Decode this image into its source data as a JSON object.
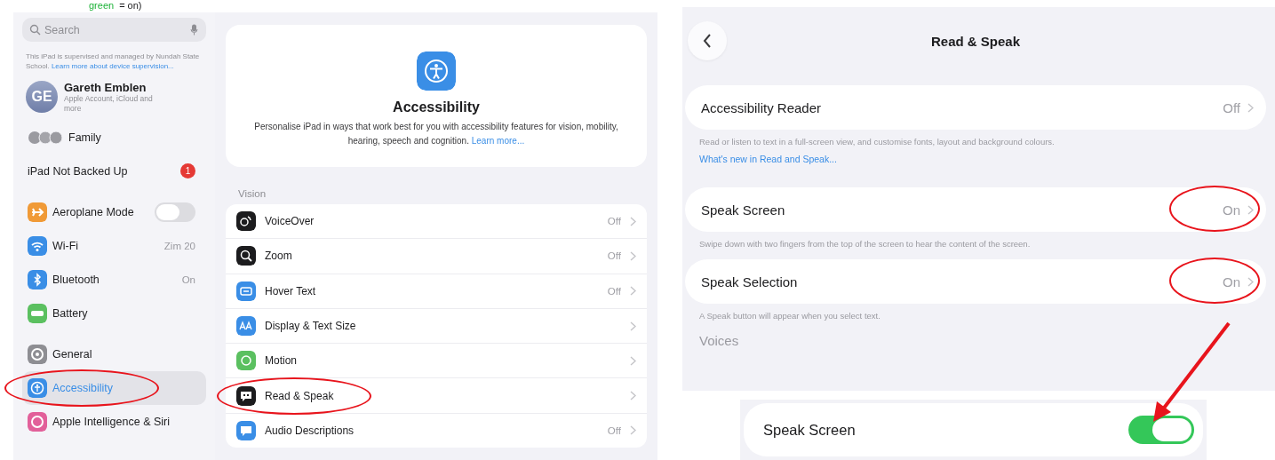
{
  "caption": {
    "highlight": "green",
    "rest": "= on)"
  },
  "left_screen": {
    "sidebar": {
      "search": {
        "placeholder": "Search"
      },
      "supervision_note": "This iPad is supervised and managed by Nundah State School.",
      "supervision_link": "Learn more about device supervision...",
      "profile": {
        "initials": "GE",
        "name": "Gareth Emblen",
        "subtitle": "Apple Account, iCloud and more"
      },
      "family": {
        "label": "Family"
      },
      "backup": {
        "label": "iPad Not Backed Up",
        "badge": "1"
      },
      "items": [
        {
          "kind": "toggle",
          "label": "Aeroplane Mode",
          "on": false,
          "selected": false,
          "circled": false
        },
        {
          "kind": "value",
          "label": "Wi-Fi",
          "value": "Zim 20",
          "selected": false,
          "circled": false
        },
        {
          "kind": "value",
          "label": "Bluetooth",
          "value": "On",
          "selected": false,
          "circled": false
        },
        {
          "kind": "plain",
          "label": "Battery",
          "selected": false,
          "circled": false
        },
        {
          "kind": "gap"
        },
        {
          "kind": "plain",
          "label": "General",
          "selected": false,
          "circled": false
        },
        {
          "kind": "plain",
          "label": "Accessibility",
          "selected": true,
          "circled": true
        },
        {
          "kind": "plain",
          "label": "Apple Intelligence & Siri",
          "selected": false,
          "circled": false
        }
      ]
    },
    "content": {
      "title": "Accessibility",
      "description": "Personalise iPad in ways that work best for you with accessibility features for vision, mobility, hearing, speech and cognition.",
      "link": "Learn more...",
      "section": "Vision",
      "rows": [
        {
          "label": "VoiceOver",
          "value": "Off",
          "circled": false
        },
        {
          "label": "Zoom",
          "value": "Off",
          "circled": false
        },
        {
          "label": "Hover Text",
          "value": "Off",
          "circled": false
        },
        {
          "label": "Display & Text Size",
          "circled": false
        },
        {
          "label": "Motion",
          "circled": false
        },
        {
          "label": "Read & Speak",
          "circled": true
        },
        {
          "label": "Audio Descriptions",
          "value": "Off",
          "circled": false
        }
      ]
    }
  },
  "right_screen": {
    "title": "Read & Speak",
    "groups": [
      {
        "label": "Accessibility Reader",
        "value": "Off",
        "circled": false,
        "footer": "Read or listen to text in a full-screen view, and customise fonts, layout and background colours.",
        "link": "What's new in Read and Speak..."
      },
      {
        "label": "Speak Screen",
        "value": "On",
        "circled": true,
        "footer": "Swipe down with two fingers from the top of the screen to hear the content of the screen."
      },
      {
        "label": "Speak Selection",
        "value": "On",
        "circled": true,
        "footer": "A Speak button will appear when you select text."
      }
    ],
    "section": "Voices"
  },
  "inset": {
    "label": "Speak Screen",
    "on": true
  }
}
